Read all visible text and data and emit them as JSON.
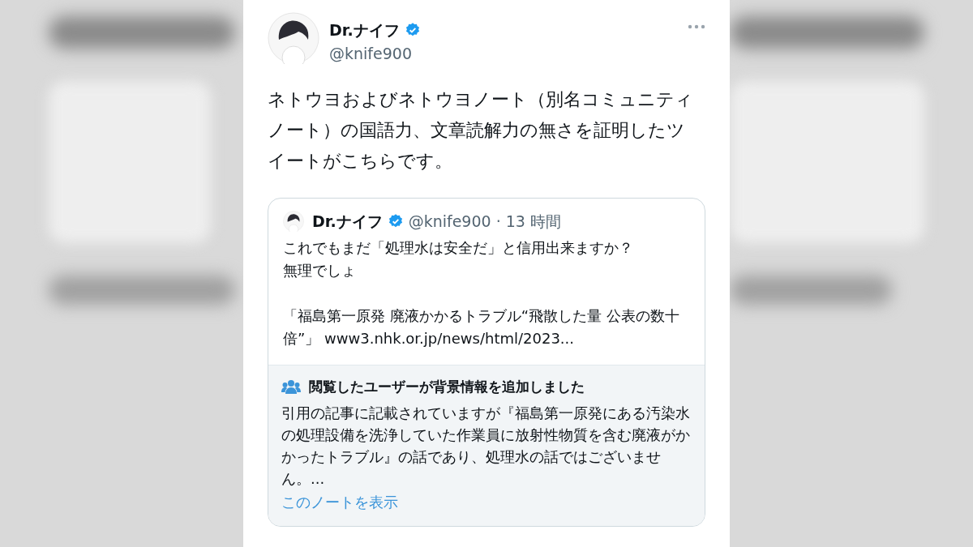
{
  "tweet": {
    "author": {
      "name": "Dr.ナイフ",
      "handle": "@knife900",
      "verified": true
    },
    "text": "ネトウヨおよびネトウヨノート（別名コミュニティノート）の国語力、文章読解力の無さを証明したツイートがこちらです。",
    "quote": {
      "author": {
        "name": "Dr.ナイフ",
        "handle": "@knife900",
        "verified": true
      },
      "separator": "·",
      "time": "13 時間",
      "paragraphs": [
        [
          "これでもまだ「処理水は安全だ」と信用出来ますか？",
          "無理でしょ"
        ],
        [
          "「福島第一原発 廃液かかるトラブル“飛散した量 公表の数十倍”」 www3.nhk.or.jp/news/html/2023..."
        ]
      ],
      "note": {
        "title": "閲覧したユーザーが背景情報を追加しました",
        "text": "引用の記事に記載されていますが『福島第一原発にある汚染水の処理設備を洗浄していた作業員に放射性物質を含む廃液がかかったトラブル』の話であり、処理水の話ではございません。...",
        "link": "このノートを表示"
      }
    }
  }
}
